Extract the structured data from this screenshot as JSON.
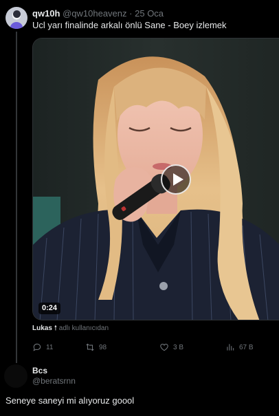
{
  "tweet": {
    "author_name": "qw10h",
    "author_handle": "@qw10heavenz",
    "separator": "·",
    "date": "25 Oca",
    "text": "Ucl yarı finalinde arkalı önlü Sane - Boey izlemek",
    "video": {
      "duration": "0:24"
    },
    "attribution": {
      "user": "Lukas",
      "icon": "arrow-up-icon",
      "suffix": "adlı kullanıcıdan"
    },
    "actions": {
      "replies": "11",
      "retweets": "98",
      "likes": "3 B",
      "views": "67 B"
    }
  },
  "reply": {
    "author_name": "Bcs",
    "author_handle": "@beratsrnn",
    "text": "Seneye saneyi mi alıyoruz goool"
  },
  "colors": {
    "background": "#000000",
    "text_primary": "#e7e9ea",
    "text_secondary": "#71767b",
    "border": "#2f3336"
  }
}
